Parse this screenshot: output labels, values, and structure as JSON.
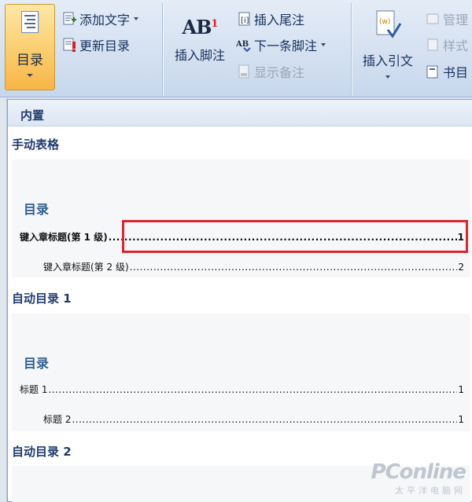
{
  "ribbon": {
    "toc_button_label": "目录",
    "add_text_label": "添加文字",
    "update_toc_label": "更新目录",
    "insert_footnote_label": "插入脚注",
    "insert_endnote_label": "插入尾注",
    "next_footnote_label": "下一条脚注",
    "show_notes_label": "显示备注",
    "insert_citation_label": "插入引文",
    "manage_label": "管理",
    "style_label": "样式",
    "bibliography_label": "书目",
    "footnote_icon_text": "AB",
    "footnote_icon_sup": "1"
  },
  "gallery": {
    "header": "内置",
    "sections": [
      {
        "title": "手动表格",
        "preview_heading": "目录",
        "entries": [
          {
            "text": "键入章标题(第 1 级)",
            "page": "1",
            "level": 1
          },
          {
            "text": "键入章标题(第 2 级)",
            "page": "2",
            "level": 2
          }
        ]
      },
      {
        "title": "自动目录 1",
        "preview_heading": "目录",
        "entries": [
          {
            "text": "标题 1",
            "page": "1",
            "level": 1
          },
          {
            "text": "标题 2",
            "page": "1",
            "level": 2
          }
        ]
      },
      {
        "title": "自动目录 2"
      }
    ]
  },
  "watermark": {
    "line1": "PConline",
    "line2": "太平洋电脑网"
  },
  "colors": {
    "highlight": "#e0242f",
    "accent": "#1f3b6e",
    "toc_button": "#f8b546"
  }
}
